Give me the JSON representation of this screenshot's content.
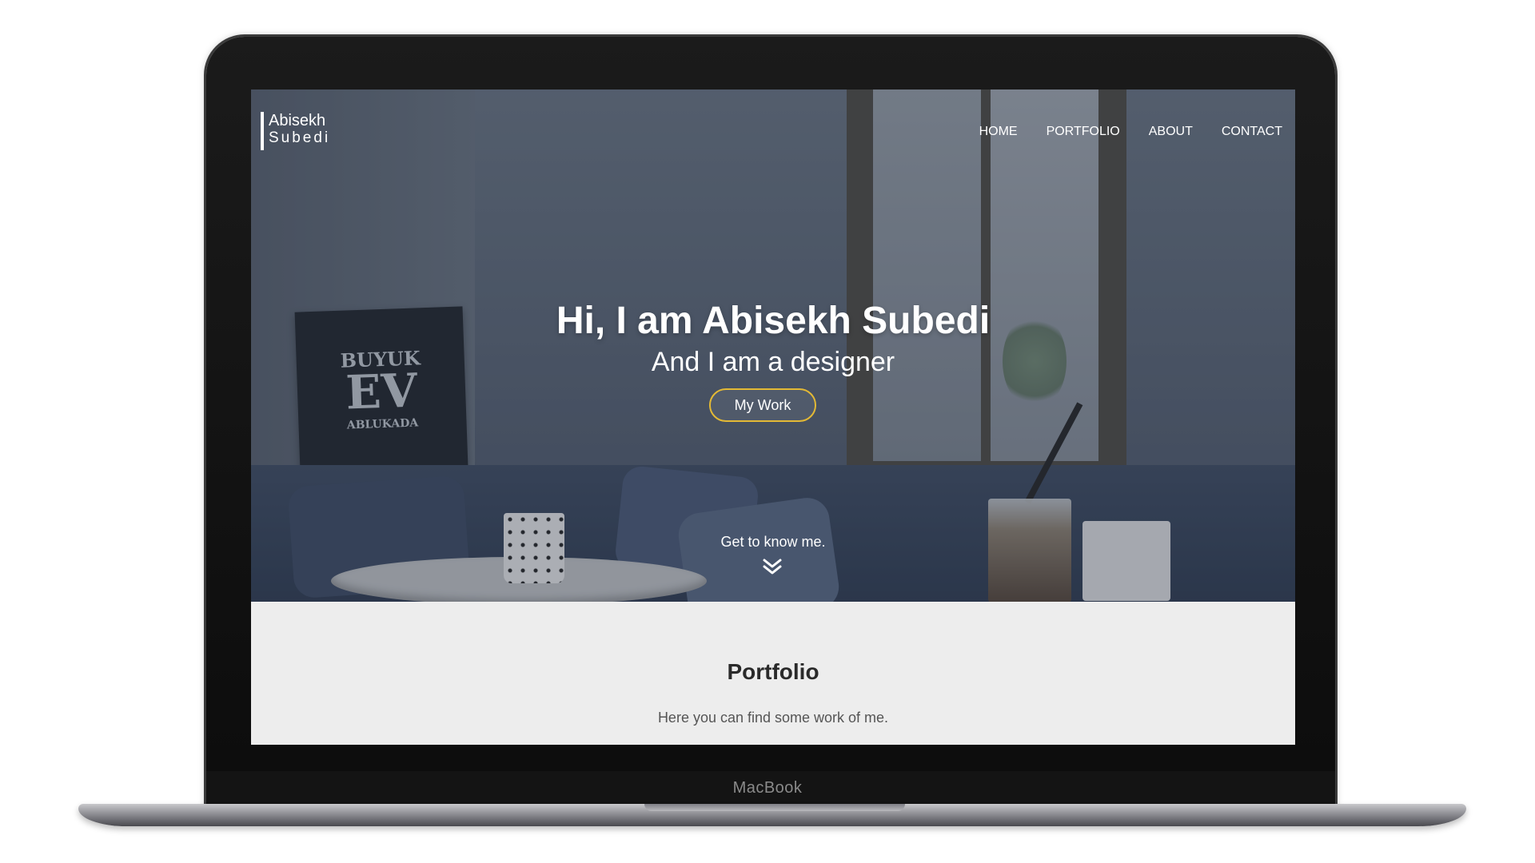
{
  "device": {
    "brand_label": "MacBook"
  },
  "site": {
    "logo": {
      "line1": "Abisekh",
      "line2": "Subedi"
    },
    "nav": [
      {
        "label": "HOME"
      },
      {
        "label": "PORTFOLIO"
      },
      {
        "label": "ABOUT"
      },
      {
        "label": "CONTACT"
      }
    ],
    "hero": {
      "title": "Hi, I am Abisekh Subedi",
      "subtitle": "And I am a designer",
      "cta_label": "My Work",
      "scroll_label": "Get to know me.",
      "scroll_icon": "double-chevron-down-icon",
      "poster_text": [
        "BUYUK",
        "EV",
        "ABLUKADA"
      ]
    },
    "portfolio": {
      "title": "Portfolio",
      "description": "Here you can find some work of me."
    }
  },
  "colors": {
    "accent": "#e3b935",
    "section_bg": "#ededed",
    "text_dark": "#2a2a2a"
  }
}
